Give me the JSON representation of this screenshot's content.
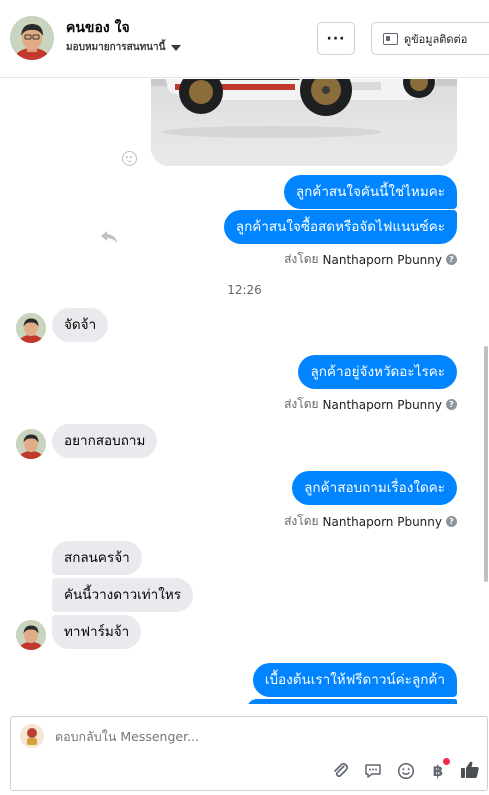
{
  "header": {
    "contact_name": "คนของ ใจ",
    "contact_subtitle": "มอบหมายการสนทนานี้",
    "more_label": "···",
    "view_contact_label": "ดูข้อมูลติดต่อ"
  },
  "messages": [
    {
      "type": "out",
      "text": "ลูกค้าสนใจคันนี้ใช่ไหมคะ"
    },
    {
      "type": "out",
      "text": "ลูกค้าสนใจซื้อสดหรือจัดไฟแนนซ์คะ"
    },
    {
      "type": "sent_by",
      "prefix": "ส่งโดย",
      "sender": "Nanthaporn Pbunny"
    },
    {
      "type": "time",
      "text": "12:26"
    },
    {
      "type": "in",
      "text": "จัดจ้า"
    },
    {
      "type": "out",
      "text": "ลูกค้าอยู่จังหวัดอะไรคะ"
    },
    {
      "type": "sent_by",
      "prefix": "ส่งโดย",
      "sender": "Nanthaporn Pbunny"
    },
    {
      "type": "in",
      "text": "อยากสอบถาม"
    },
    {
      "type": "out",
      "text": "ลูกค้าสอบถามเรื่องใดคะ"
    },
    {
      "type": "sent_by",
      "prefix": "ส่งโดย",
      "sender": "Nanthaporn Pbunny"
    },
    {
      "type": "in",
      "text": "สกลนครจ้า"
    },
    {
      "type": "in",
      "text": "คันนี้วางดาวเท่าใหร"
    },
    {
      "type": "in",
      "text": "ทาฟาร์มจ้า"
    },
    {
      "type": "out",
      "text": "เบื้องต้นเราให้ฟรีดาวน์ค่ะลูกค้า"
    }
  ],
  "composer": {
    "placeholder": "ตอบกลับใน Messenger..."
  },
  "toolbar_icons": [
    "attachment-icon",
    "saved-replies-icon",
    "emoji-icon",
    "payment-icon",
    "like-icon"
  ],
  "colors": {
    "outgoing_bubble": "#0084ff",
    "incoming_bubble": "#e9eaed",
    "notification_dot": "#f02849"
  }
}
